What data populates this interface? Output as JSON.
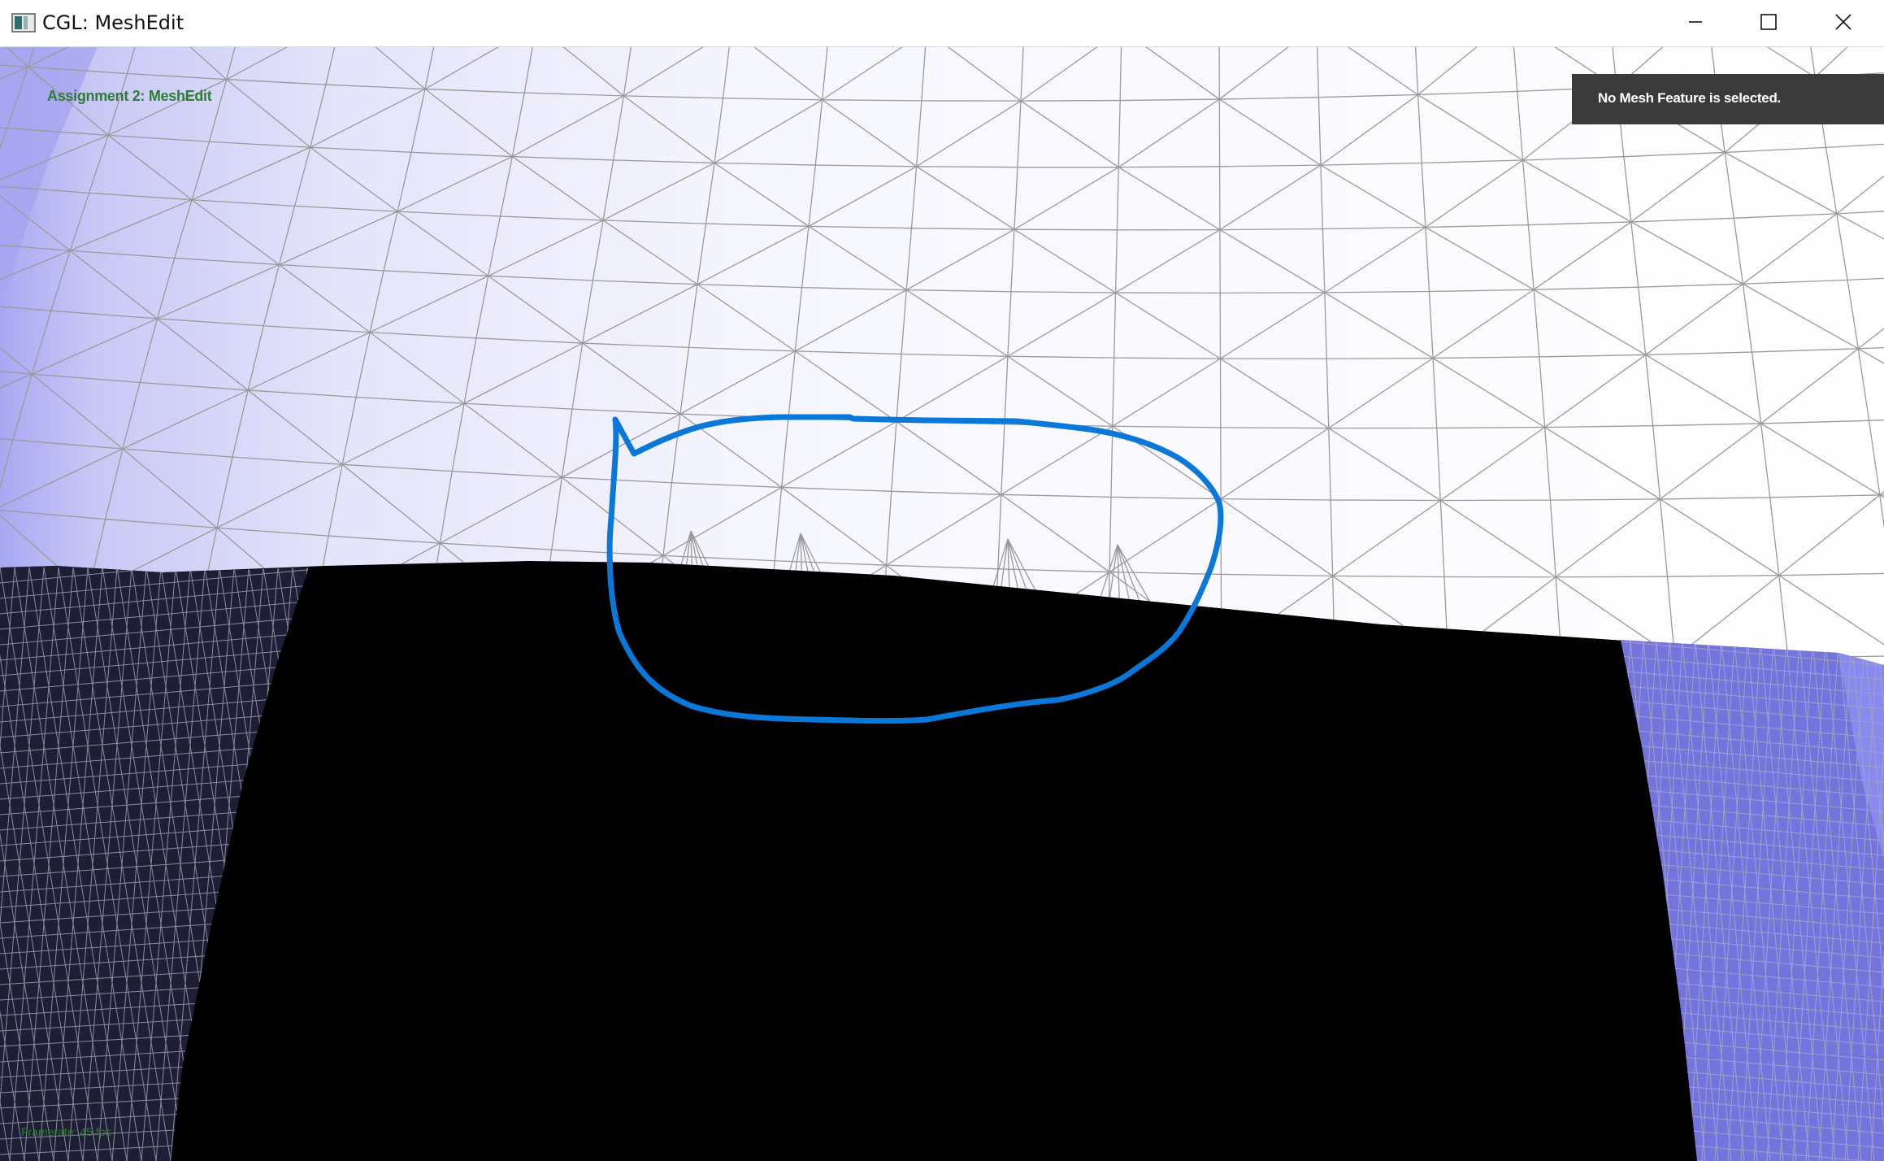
{
  "window": {
    "title": "CGL: MeshEdit",
    "icons": {
      "app": "app-window-icon",
      "minimize": "minimize-icon",
      "maximize": "maximize-icon",
      "close": "close-icon"
    }
  },
  "viewport": {
    "hud_title": "Assignment 2: MeshEdit",
    "status_message": "No Mesh Feature is selected.",
    "framerate_label": "Framerate: 45 fps"
  },
  "colors": {
    "hud_text": "#2e7d32",
    "status_panel": "#3a3a3a",
    "annotation_stroke": "#0a78d8",
    "mesh_lines": "#9a9a9a",
    "background": "#000000"
  }
}
